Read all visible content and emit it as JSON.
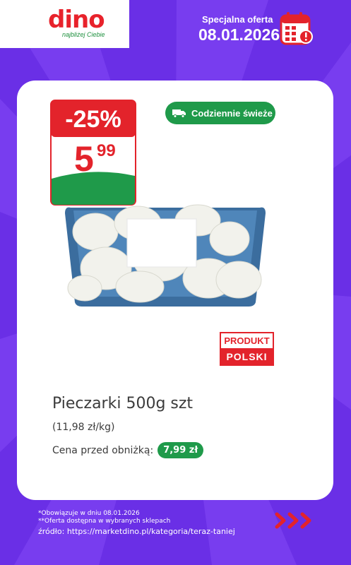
{
  "brand": {
    "name": "dino",
    "tagline": "najbliżej Ciebie"
  },
  "offer": {
    "label": "Specjalna oferta",
    "date": "08.01.2026"
  },
  "price_tag": {
    "discount": "-25%",
    "price_main": "5",
    "price_cents": "99"
  },
  "fresh_badge": {
    "label": "Codziennie świeże"
  },
  "origin_badge": {
    "line1": "PRODUKT",
    "line2": "POLSKI"
  },
  "product": {
    "name": "Pieczarki 500g szt",
    "unit_price": "(11,98 zł/kg)",
    "prev_label": "Cena przed obniżką:",
    "prev_price": "7,99 zł"
  },
  "footer": {
    "note1": "*Obowiązuje w dniu 08.01.2026",
    "note2": "**Oferta dostępna w wybranych sklepach",
    "source": "źródło: https://marketdino.pl/kategoria/teraz-taniej"
  },
  "colors": {
    "background": "#6a2fe6",
    "red": "#e3232b",
    "green": "#1f9a4a"
  }
}
